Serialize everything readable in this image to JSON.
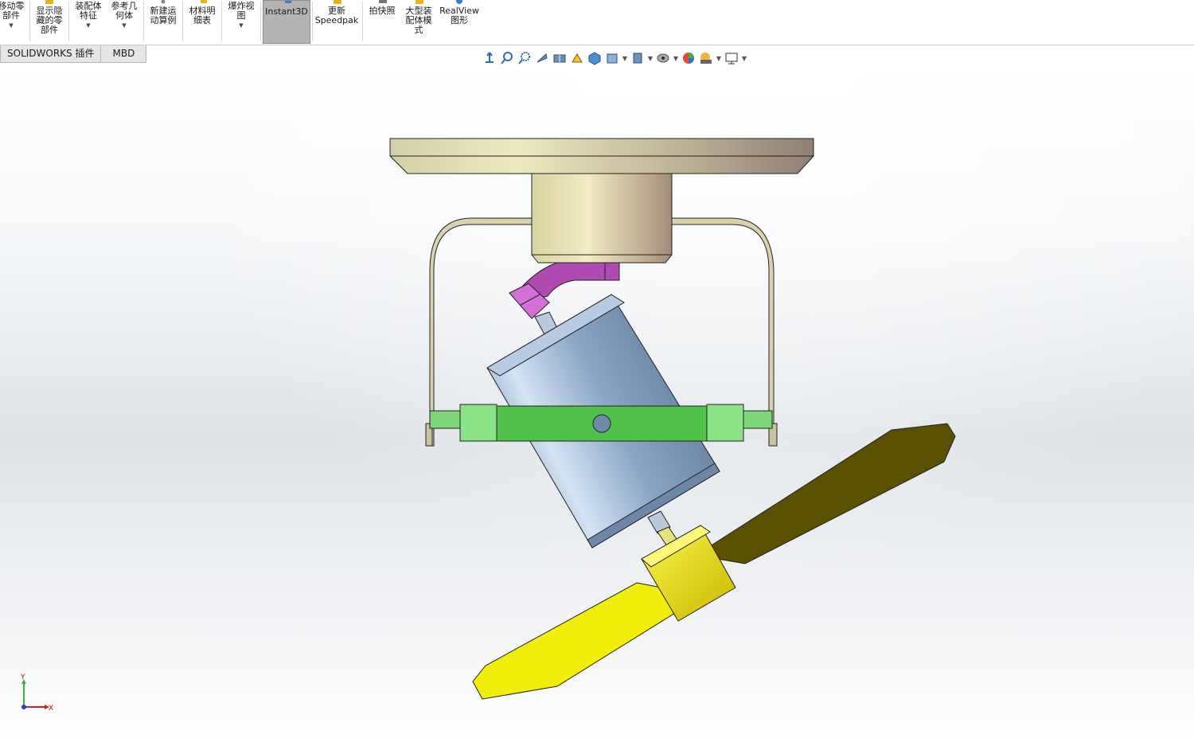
{
  "ribbon": {
    "buttons": [
      {
        "id": "move-component",
        "label": "移动零\n部件"
      },
      {
        "id": "show-hidden",
        "label": "显示隐\n藏的零\n部件"
      },
      {
        "id": "assembly-features",
        "label": "装配体\n特征"
      },
      {
        "id": "reference-geometry",
        "label": "参考几\n何体"
      },
      {
        "id": "new-motion-study",
        "label": "新建运\n动算例"
      },
      {
        "id": "bill-of-materials",
        "label": "材料明\n细表"
      },
      {
        "id": "exploded-view",
        "label": "爆炸视\n图"
      },
      {
        "id": "instant3d",
        "label": "Instant3D"
      },
      {
        "id": "update-speedpak",
        "label": "更新\nSpeedpak"
      },
      {
        "id": "snapshot",
        "label": "拍快照"
      },
      {
        "id": "large-assembly-mode",
        "label": "大型装\n配体模\n式"
      },
      {
        "id": "realview",
        "label": "RealView\n图形"
      }
    ]
  },
  "tabs": [
    {
      "label": "SOLIDWORKS 插件"
    },
    {
      "label": "MBD"
    }
  ],
  "triad": {
    "x_label": "X",
    "y_label": "Y"
  },
  "colors": {
    "plate": "#c9c6a2",
    "housing": "#d6d2a6",
    "bracket": "#d4cfac",
    "motor": "#7f9bbd",
    "ring": "#5cbf5a",
    "arm": "#b24db5",
    "blade_dark": "#5c5200",
    "blade_light": "#f2ef00",
    "hub": "#e8df15",
    "tab_bg": "#e6e6e6"
  }
}
